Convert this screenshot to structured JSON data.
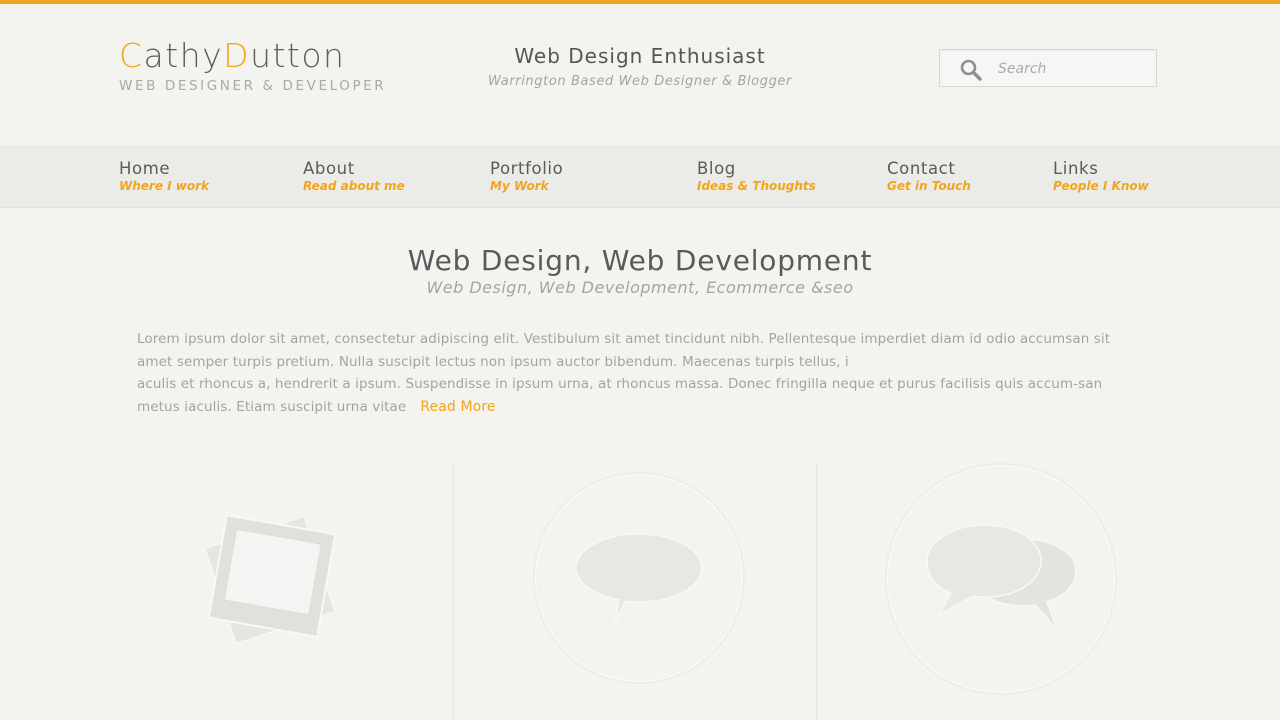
{
  "header": {
    "logo": {
      "first_initial": "C",
      "first_rest": "athy",
      "last_initial": "D",
      "last_rest": "utton",
      "subtitle": "WEB DESIGNER & DEVELOPER"
    },
    "tagline": {
      "title": "Web Design Enthusiast",
      "subtitle": "Warrington Based Web Designer & Blogger"
    },
    "search": {
      "placeholder": "Search",
      "icon": "search-icon"
    }
  },
  "nav": {
    "items": [
      {
        "label": "Home",
        "sub": "Where I work"
      },
      {
        "label": "About",
        "sub": "Read about me"
      },
      {
        "label": "Portfolio",
        "sub": "My Work"
      },
      {
        "label": "Blog",
        "sub": "Ideas & Thoughts"
      },
      {
        "label": "Contact",
        "sub": "Get in Touch"
      },
      {
        "label": "Links",
        "sub": "People I Know"
      }
    ]
  },
  "intro": {
    "title": "Web Design, Web Development",
    "subtitle": "Web Design, Web Development, Ecommerce &seo",
    "paragraph_1": "Lorem ipsum dolor sit amet, consectetur adipiscing elit. Vestibulum sit amet tincidunt nibh. Pellentesque imperdiet diam id odio accumsan sit amet semper turpis pretium. Nulla suscipit lectus non ipsum auctor bibendum. Maecenas turpis tellus, i",
    "paragraph_2": "aculis et rhoncus a, hendrerit a ipsum. Suspendisse in ipsum urna, at rhoncus massa. Donec fringilla neque et purus facilisis quis accum-san metus iaculis. Etiam suscipit urna vitae",
    "read_more": "Read More"
  },
  "features": [
    {
      "icon": "photos-icon"
    },
    {
      "icon": "speech-bubble-icon"
    },
    {
      "icon": "conversation-icon"
    }
  ],
  "colors": {
    "accent": "#f2a51c",
    "background": "#f3f3f0",
    "nav_background": "#ebebe8"
  }
}
